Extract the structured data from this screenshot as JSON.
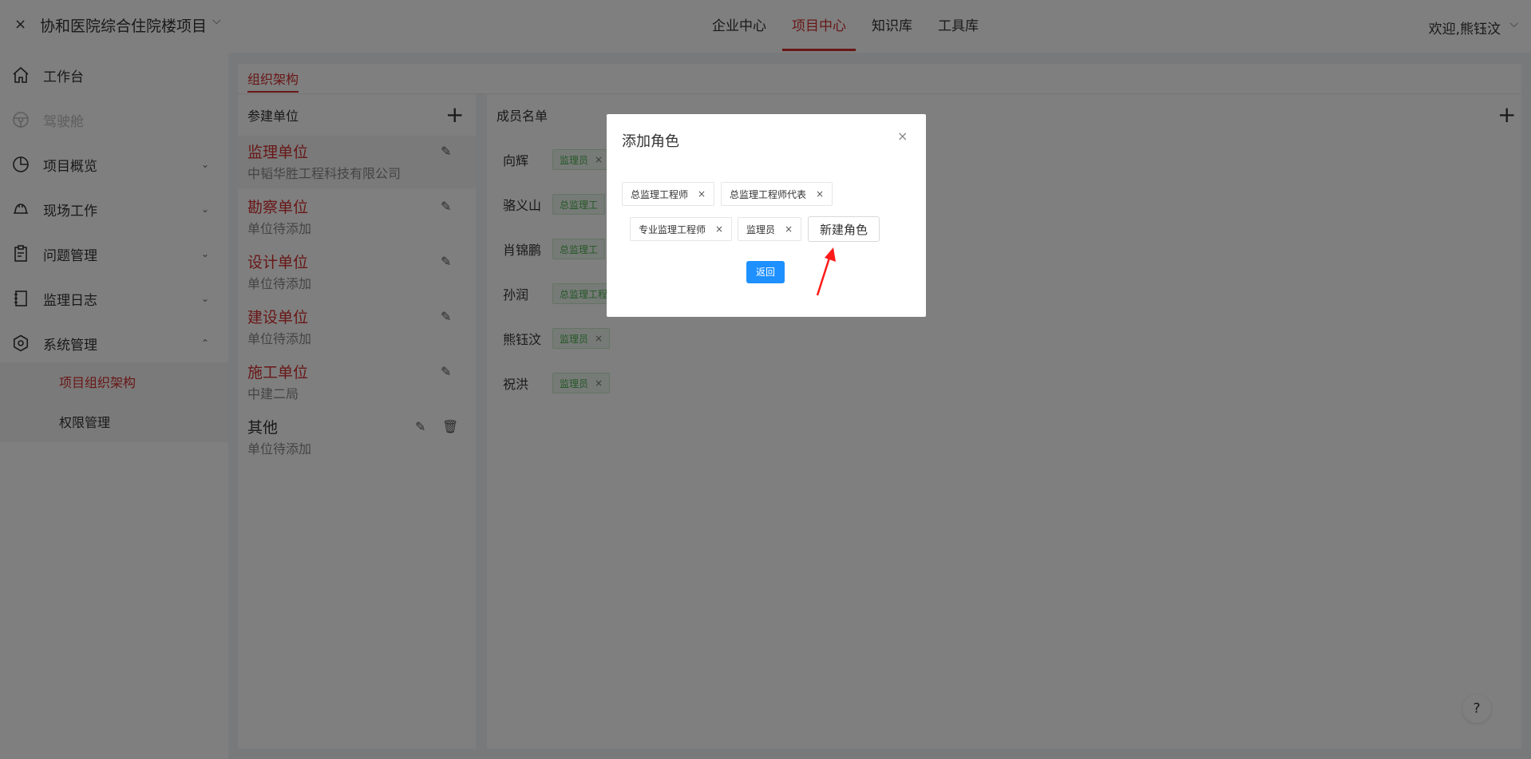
{
  "topbar": {
    "close_glyph": "×",
    "project_title": "协和医院综合住院楼项目",
    "project_chevron": "⌵",
    "nav": [
      "企业中心",
      "项目中心",
      "知识库",
      "工具库"
    ],
    "active_nav": "项目中心",
    "welcome": "欢迎,熊钰汶",
    "welcome_chevron": "⌵"
  },
  "sidebar": {
    "items": [
      {
        "label": "工作台",
        "icon": "home-icon"
      },
      {
        "label": "驾驶舱",
        "icon": "steering-wheel-icon",
        "disabled": true
      },
      {
        "label": "项目概览",
        "icon": "pie-chart-icon"
      },
      {
        "label": "现场工作",
        "icon": "helmet-icon"
      },
      {
        "label": "问题管理",
        "icon": "clipboard-icon"
      },
      {
        "label": "监理日志",
        "icon": "notebook-icon"
      },
      {
        "label": "系统管理",
        "icon": "gear-icon"
      }
    ],
    "chevron_down": "⌄",
    "chevron_up": "⌃",
    "sub_items": [
      "项目组织架构",
      "权限管理"
    ],
    "active_sub": "项目组织架构"
  },
  "main": {
    "tab": "组织架构",
    "left_panel": {
      "header": "参建单位",
      "plus": "+",
      "units": [
        {
          "name": "监理单位",
          "sub": "中韬华胜工程科技有限公司"
        },
        {
          "name": "勘察单位",
          "sub": "单位待添加"
        },
        {
          "name": "设计单位",
          "sub": "单位待添加"
        },
        {
          "name": "建设单位",
          "sub": "单位待添加"
        },
        {
          "name": "施工单位",
          "sub": "中建二局"
        },
        {
          "name": "其他",
          "sub": "单位待添加"
        }
      ],
      "edit_glyph": "✎",
      "delete_glyph": "🗑"
    },
    "right_panel": {
      "header": "成员名单",
      "plus": "+",
      "members": [
        {
          "name": "向辉",
          "role": "监理员"
        },
        {
          "name": "骆义山",
          "role": "总监理工"
        },
        {
          "name": "肖锦鹏",
          "role": "总监理工"
        },
        {
          "name": "孙润",
          "role": "总监理工程"
        },
        {
          "name": "熊钰汶",
          "role": "监理员"
        },
        {
          "name": "祝洪",
          "role": "监理员"
        }
      ],
      "tag_close": "×"
    }
  },
  "help": "?",
  "modal": {
    "title": "添加角色",
    "close": "×",
    "roles": [
      "总监理工程师",
      "总监理工程师代表",
      "专业监理工程师",
      "监理员"
    ],
    "role_close": "×",
    "new_role_button": "新建角色",
    "back_button": "返回"
  },
  "colors": {
    "accent": "#d32f2f",
    "primary_button": "#1e90ff",
    "tag_green": "#4caf50",
    "arrow": "#ff1a1a"
  }
}
